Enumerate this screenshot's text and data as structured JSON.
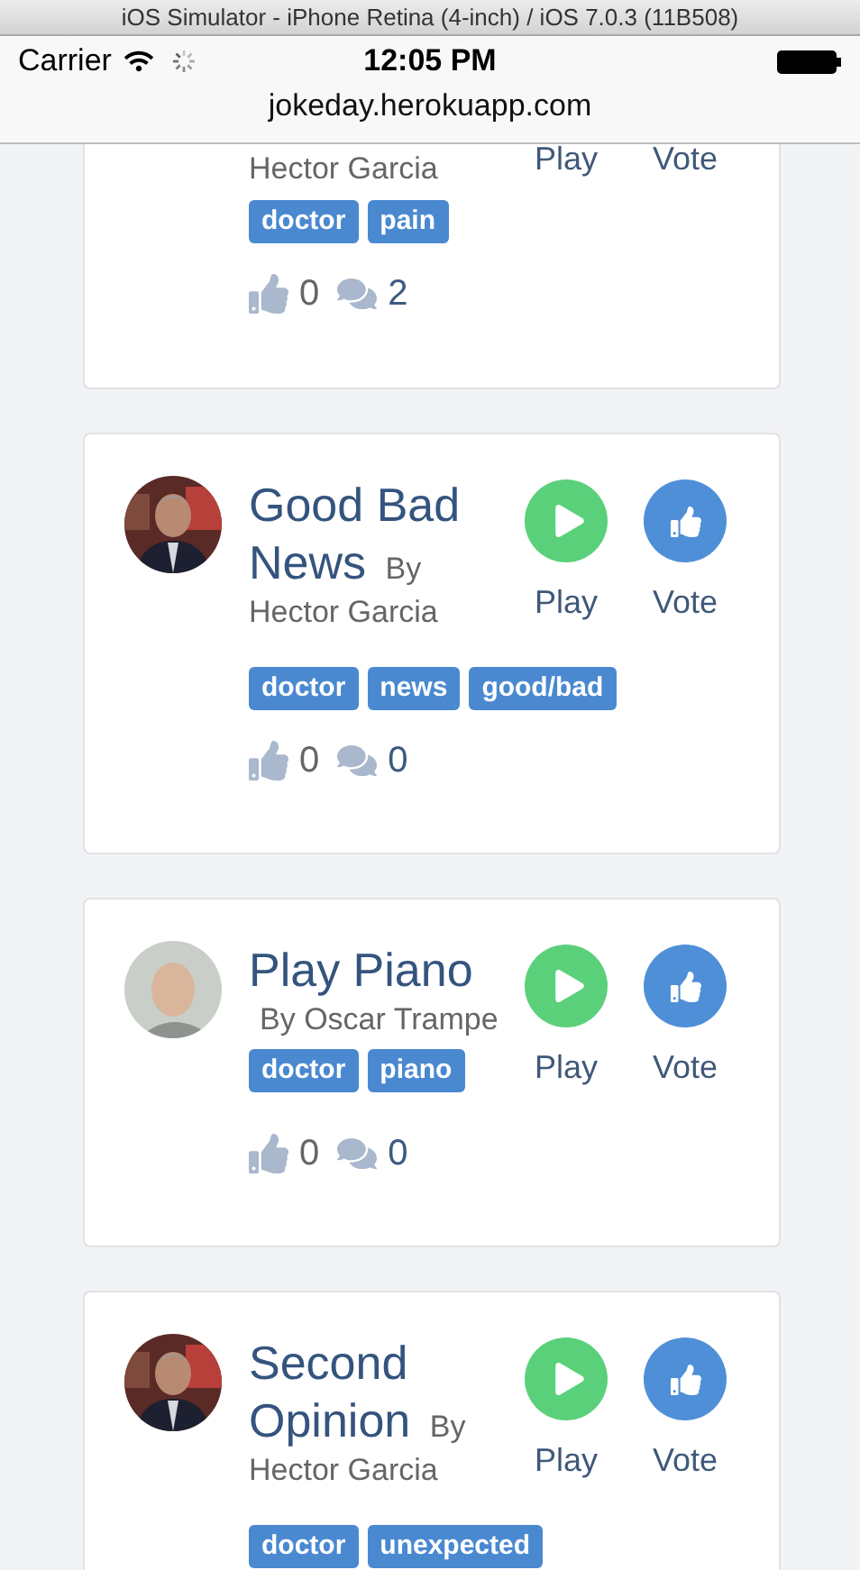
{
  "window": {
    "title": "iOS Simulator - iPhone Retina (4-inch) / iOS 7.0.3 (11B508)"
  },
  "status_bar": {
    "carrier": "Carrier",
    "time": "12:05 PM"
  },
  "address_bar": {
    "url": "jokeday.herokuapp.com"
  },
  "jokes": [
    {
      "kind": "clipped",
      "author": "Hector Garcia",
      "play_label": "Play",
      "vote_label": "Vote",
      "tags": [
        "doctor",
        "pain"
      ],
      "votes": "0",
      "comments": "2"
    },
    {
      "kind": "full",
      "title_lines": [
        "Good Bad",
        "News"
      ],
      "by": "By",
      "author": "Hector Garcia",
      "play_label": "Play",
      "vote_label": "Vote",
      "tags": [
        "doctor",
        "news",
        "good/bad"
      ],
      "votes": "0",
      "comments": "0"
    },
    {
      "kind": "full",
      "title_lines": [
        "Play Piano"
      ],
      "by": "By",
      "author": "Oscar Trampe",
      "play_label": "Play",
      "vote_label": "Vote",
      "tags": [
        "doctor",
        "piano"
      ],
      "votes": "0",
      "comments": "0"
    },
    {
      "kind": "full",
      "title_lines": [
        "Second",
        "Opinion"
      ],
      "by": "By",
      "author": "Hector Garcia",
      "play_label": "Play",
      "vote_label": "Vote",
      "tags": [
        "doctor",
        "unexpected"
      ]
    }
  ]
}
